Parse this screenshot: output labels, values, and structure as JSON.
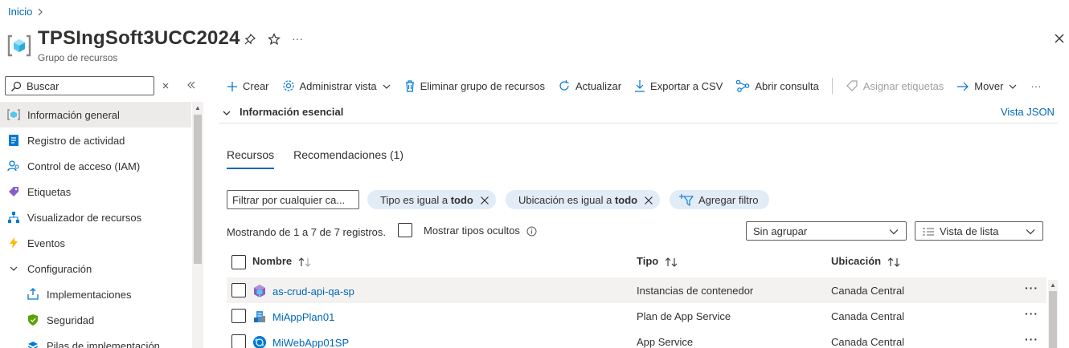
{
  "breadcrumb": {
    "home": "Inicio"
  },
  "header": {
    "title": "TPSIngSoft3UCC2024",
    "subtitle": "Grupo de recursos",
    "more": "···"
  },
  "sidebar": {
    "search_placeholder": "Buscar",
    "items": [
      {
        "label": "Información general",
        "icon": "resource-group-icon"
      },
      {
        "label": "Registro de actividad",
        "icon": "activity-log-icon"
      },
      {
        "label": "Control de acceso (IAM)",
        "icon": "iam-icon"
      },
      {
        "label": "Etiquetas",
        "icon": "tag-icon"
      },
      {
        "label": "Visualizador de recursos",
        "icon": "visualizer-icon"
      },
      {
        "label": "Eventos",
        "icon": "events-icon"
      },
      {
        "label": "Configuración",
        "icon": "chevron-down-icon"
      },
      {
        "label": "Implementaciones",
        "icon": "deployments-icon"
      },
      {
        "label": "Seguridad",
        "icon": "security-icon"
      },
      {
        "label": "Pilas de implementación",
        "icon": "stacks-icon"
      }
    ]
  },
  "toolbar": {
    "create": "Crear",
    "manage_view": "Administrar vista",
    "delete_group": "Eliminar grupo de recursos",
    "refresh": "Actualizar",
    "export_csv": "Exportar a CSV",
    "open_query": "Abrir consulta",
    "assign_tags": "Asignar etiquetas",
    "move": "Mover",
    "more": "···"
  },
  "essentials": {
    "title": "Información esencial",
    "json_view": "Vista JSON"
  },
  "tabs": {
    "resources": "Recursos",
    "recommendations": "Recomendaciones (1)"
  },
  "filters": {
    "placeholder": "Filtrar por cualquier ca...",
    "type_prefix": "Tipo es igual a ",
    "type_value": "todo",
    "location_prefix": "Ubicación es igual a ",
    "location_value": "todo",
    "add_filter": "Agregar filtro"
  },
  "listing": {
    "showing": "Mostrando de 1 a 7 de 7 registros.",
    "show_hidden": "Mostrar tipos ocultos",
    "grouping": "Sin agrupar",
    "view": "Vista de lista"
  },
  "table": {
    "columns": {
      "name": "Nombre",
      "type": "Tipo",
      "location": "Ubicación"
    },
    "rows": [
      {
        "name": "as-crud-api-qa-sp",
        "type": "Instancias de contenedor",
        "location": "Canada Central",
        "icon": "container-instance-icon"
      },
      {
        "name": "MiAppPlan01",
        "type": "Plan de App Service",
        "location": "Canada Central",
        "icon": "app-service-plan-icon"
      },
      {
        "name": "MiWebApp01SP",
        "type": "App Service",
        "location": "Canada Central",
        "icon": "app-service-icon"
      }
    ],
    "more": "···"
  },
  "colors": {
    "accent": "#0067b8",
    "pill": "#e1ecf7",
    "active_row": "#edebe9"
  }
}
